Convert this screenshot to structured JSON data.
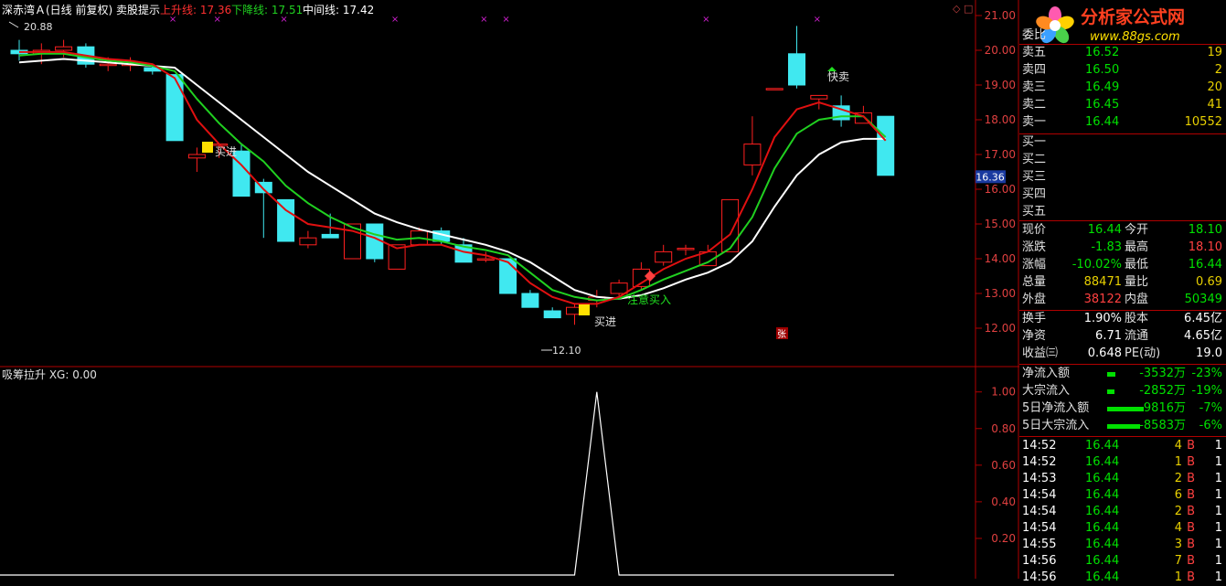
{
  "title_bar": {
    "stock_name": "深赤湾Ａ(日线 前复权) 卖股提示",
    "upline": "上升线: 17.36",
    "downline": "下降线: 17.51",
    "midline": "中间线: 17.42"
  },
  "logo": {
    "text": "分析家公式网",
    "url": "www.88gs.com"
  },
  "colors": {
    "bg": "#000000",
    "rise": "#ff2020",
    "fall": "#40e8f0",
    "red_line": "#e01010",
    "green_line": "#20d020",
    "white_line": "#ffffff",
    "grid": "#b00000"
  },
  "chart_data": [
    {
      "type": "candlestick",
      "title": "深赤湾Ａ(日线 前复权) 卖股提示",
      "ylim": [
        11.7,
        21.3
      ],
      "y_ticks": [
        "21.00",
        "20.00",
        "19.00",
        "18.00",
        "17.00",
        "16.00",
        "15.00",
        "14.00",
        "13.00",
        "12.00"
      ],
      "price_marker": "16.36",
      "candles": [
        {
          "o": 20.0,
          "h": 20.3,
          "l": 19.7,
          "c": 19.9
        },
        {
          "o": 19.9,
          "h": 20.2,
          "l": 19.6,
          "c": 20.0
        },
        {
          "o": 20.0,
          "h": 20.3,
          "l": 19.8,
          "c": 20.1
        },
        {
          "o": 20.1,
          "h": 20.2,
          "l": 19.5,
          "c": 19.6
        },
        {
          "o": 19.6,
          "h": 19.8,
          "l": 19.4,
          "c": 19.6
        },
        {
          "o": 19.6,
          "h": 19.8,
          "l": 19.4,
          "c": 19.6
        },
        {
          "o": 19.5,
          "h": 19.6,
          "l": 19.3,
          "c": 19.4
        },
        {
          "o": 19.3,
          "h": 19.3,
          "l": 17.4,
          "c": 17.4
        },
        {
          "o": 16.9,
          "h": 17.2,
          "l": 16.5,
          "c": 17.0
        },
        {
          "o": 17.3,
          "h": 17.3,
          "l": 16.9,
          "c": 17.3
        },
        {
          "o": 17.1,
          "h": 17.3,
          "l": 15.8,
          "c": 15.8
        },
        {
          "o": 16.2,
          "h": 16.3,
          "l": 14.6,
          "c": 15.9
        },
        {
          "o": 15.7,
          "h": 15.7,
          "l": 14.5,
          "c": 14.5
        },
        {
          "o": 14.4,
          "h": 14.8,
          "l": 14.3,
          "c": 14.6
        },
        {
          "o": 14.7,
          "h": 15.3,
          "l": 14.6,
          "c": 14.6
        },
        {
          "o": 14.0,
          "h": 15.0,
          "l": 14.0,
          "c": 15.0
        },
        {
          "o": 15.0,
          "h": 15.0,
          "l": 13.9,
          "c": 14.0
        },
        {
          "o": 13.7,
          "h": 14.4,
          "l": 13.7,
          "c": 14.4
        },
        {
          "o": 14.4,
          "h": 14.9,
          "l": 14.4,
          "c": 14.8
        },
        {
          "o": 14.8,
          "h": 14.9,
          "l": 14.4,
          "c": 14.5
        },
        {
          "o": 14.4,
          "h": 14.6,
          "l": 13.9,
          "c": 13.9
        },
        {
          "o": 14.0,
          "h": 14.2,
          "l": 13.9,
          "c": 14.0
        },
        {
          "o": 14.0,
          "h": 14.0,
          "l": 13.0,
          "c": 13.0
        },
        {
          "o": 13.0,
          "h": 13.1,
          "l": 12.6,
          "c": 12.6
        },
        {
          "o": 12.5,
          "h": 12.6,
          "l": 12.3,
          "c": 12.3
        },
        {
          "o": 12.4,
          "h": 12.7,
          "l": 12.1,
          "c": 12.6
        },
        {
          "o": 12.8,
          "h": 13.1,
          "l": 12.6,
          "c": 12.9
        },
        {
          "o": 13.0,
          "h": 13.4,
          "l": 12.9,
          "c": 13.3
        },
        {
          "o": 13.2,
          "h": 13.9,
          "l": 13.1,
          "c": 13.7
        },
        {
          "o": 13.9,
          "h": 14.4,
          "l": 13.8,
          "c": 14.2
        },
        {
          "o": 14.3,
          "h": 14.4,
          "l": 14.1,
          "c": 14.3
        },
        {
          "o": 13.8,
          "h": 14.4,
          "l": 13.8,
          "c": 14.2
        },
        {
          "o": 14.2,
          "h": 15.7,
          "l": 14.2,
          "c": 15.7
        },
        {
          "o": 16.7,
          "h": 18.1,
          "l": 16.4,
          "c": 17.3
        },
        {
          "o": 18.9,
          "h": 18.9,
          "l": 18.9,
          "c": 18.9
        },
        {
          "o": 19.9,
          "h": 20.7,
          "l": 18.9,
          "c": 19.0
        },
        {
          "o": 18.6,
          "h": 18.7,
          "l": 18.3,
          "c": 18.7
        },
        {
          "o": 18.4,
          "h": 18.7,
          "l": 17.8,
          "c": 18.0
        },
        {
          "o": 17.9,
          "h": 18.4,
          "l": 17.9,
          "c": 18.2
        },
        {
          "o": 18.1,
          "h": 18.1,
          "l": 16.4,
          "c": 16.4
        }
      ],
      "series": [
        {
          "name": "上升线",
          "color": "#e01010",
          "values": [
            19.95,
            19.95,
            19.95,
            19.85,
            19.75,
            19.7,
            19.6,
            19.2,
            18.0,
            17.3,
            16.7,
            16.0,
            15.4,
            15.0,
            14.9,
            14.8,
            14.6,
            14.3,
            14.4,
            14.4,
            14.2,
            14.1,
            13.9,
            13.3,
            12.9,
            12.7,
            12.7,
            12.9,
            13.3,
            13.7,
            14.0,
            14.2,
            14.7,
            16.0,
            17.5,
            18.3,
            18.5,
            18.3,
            18.1,
            17.4
          ]
        },
        {
          "name": "下降线",
          "color": "#20d020",
          "values": [
            19.85,
            19.9,
            19.9,
            19.8,
            19.7,
            19.65,
            19.55,
            19.4,
            18.6,
            17.9,
            17.3,
            16.8,
            16.1,
            15.6,
            15.2,
            14.9,
            14.7,
            14.55,
            14.6,
            14.5,
            14.35,
            14.25,
            14.1,
            13.6,
            13.1,
            12.9,
            12.8,
            12.85,
            13.1,
            13.4,
            13.65,
            13.9,
            14.3,
            15.2,
            16.6,
            17.6,
            18.0,
            18.1,
            18.1,
            17.5
          ]
        },
        {
          "name": "中间线",
          "color": "#ffffff",
          "values": [
            19.65,
            19.7,
            19.75,
            19.7,
            19.65,
            19.6,
            19.55,
            19.5,
            19.0,
            18.5,
            18.0,
            17.5,
            17.0,
            16.5,
            16.1,
            15.7,
            15.3,
            15.05,
            14.85,
            14.7,
            14.55,
            14.4,
            14.2,
            13.9,
            13.5,
            13.1,
            12.9,
            12.85,
            12.95,
            13.15,
            13.4,
            13.6,
            13.9,
            14.5,
            15.5,
            16.4,
            17.0,
            17.35,
            17.45,
            17.45
          ]
        }
      ],
      "annotations": {
        "high_label": "20.88",
        "low_label": "12.10",
        "buy_label": "买进",
        "buy_alert": "注意买入",
        "sell_label": "快卖",
        "zhang": "张"
      }
    },
    {
      "type": "line",
      "title": "吸筹拉升 XG: 0.00",
      "ylim": [
        0,
        1.08
      ],
      "y_ticks": [
        "1.00",
        "0.80",
        "0.60",
        "0.40",
        "0.20"
      ],
      "series": [
        {
          "name": "XG",
          "values": [
            0,
            0,
            0,
            0,
            0,
            0,
            0,
            0,
            0,
            0,
            0,
            0,
            0,
            0,
            0,
            0,
            0,
            0,
            0,
            0,
            0,
            0,
            0,
            0,
            0,
            0,
            1,
            0,
            0,
            0,
            0,
            0,
            0,
            0,
            0,
            0,
            0,
            0,
            0,
            0
          ]
        }
      ]
    }
  ],
  "quote_panel": {
    "weibi_label": "委比",
    "sells": [
      {
        "label": "卖五",
        "price": "16.52",
        "vol": "19"
      },
      {
        "label": "卖四",
        "price": "16.50",
        "vol": "2"
      },
      {
        "label": "卖三",
        "price": "16.49",
        "vol": "20"
      },
      {
        "label": "卖二",
        "price": "16.45",
        "vol": "41"
      },
      {
        "label": "卖一",
        "price": "16.44",
        "vol": "10552"
      }
    ],
    "buys": [
      "买一",
      "买二",
      "买三",
      "买四",
      "买五"
    ],
    "stats": [
      {
        "l1": "现价",
        "v1": "16.44",
        "l2": "今开",
        "v2": "18.10"
      },
      {
        "l1": "涨跌",
        "v1": "-1.83",
        "l2": "最高",
        "v2": "18.10"
      },
      {
        "l1": "涨幅",
        "v1": "-10.02%",
        "l2": "最低",
        "v2": "16.44"
      },
      {
        "l1": "总量",
        "v1": "88471",
        "l2": "量比",
        "v2": "0.69"
      },
      {
        "l1": "外盘",
        "v1": "38122",
        "l2": "内盘",
        "v2": "50349"
      }
    ],
    "stats2": [
      {
        "l1": "换手",
        "v1": "1.90%",
        "l2": "股本",
        "v2": "6.45亿"
      },
      {
        "l1": "净资",
        "v1": "6.71",
        "l2": "流通",
        "v2": "4.65亿"
      },
      {
        "l1": "收益㈢",
        "v1": "0.648",
        "l2": "PE(动)",
        "v2": "19.0"
      }
    ],
    "flows": [
      {
        "label": "净流入额",
        "value": "-3532万",
        "pct": "-23%",
        "bar": 0.23
      },
      {
        "label": "大宗流入",
        "value": "-2852万",
        "pct": "-19%",
        "bar": 0.19
      },
      {
        "label": "5日净流入额",
        "value": "-9816万",
        "pct": "-7%",
        "bar": 1.0
      },
      {
        "label": "5日大宗流入",
        "value": "-8583万",
        "pct": "-6%",
        "bar": 0.9
      }
    ],
    "ticks": [
      {
        "time": "14:52",
        "price": "16.44",
        "vol": "4",
        "bs": "B",
        "n": "1"
      },
      {
        "time": "14:52",
        "price": "16.44",
        "vol": "1",
        "bs": "B",
        "n": "1"
      },
      {
        "time": "14:53",
        "price": "16.44",
        "vol": "2",
        "bs": "B",
        "n": "1"
      },
      {
        "time": "14:54",
        "price": "16.44",
        "vol": "6",
        "bs": "B",
        "n": "1"
      },
      {
        "time": "14:54",
        "price": "16.44",
        "vol": "2",
        "bs": "B",
        "n": "1"
      },
      {
        "time": "14:54",
        "price": "16.44",
        "vol": "4",
        "bs": "B",
        "n": "1"
      },
      {
        "time": "14:55",
        "price": "16.44",
        "vol": "3",
        "bs": "B",
        "n": "1"
      },
      {
        "time": "14:56",
        "price": "16.44",
        "vol": "7",
        "bs": "B",
        "n": "1"
      },
      {
        "time": "14:56",
        "price": "16.44",
        "vol": "1",
        "bs": "B",
        "n": "1"
      }
    ]
  }
}
